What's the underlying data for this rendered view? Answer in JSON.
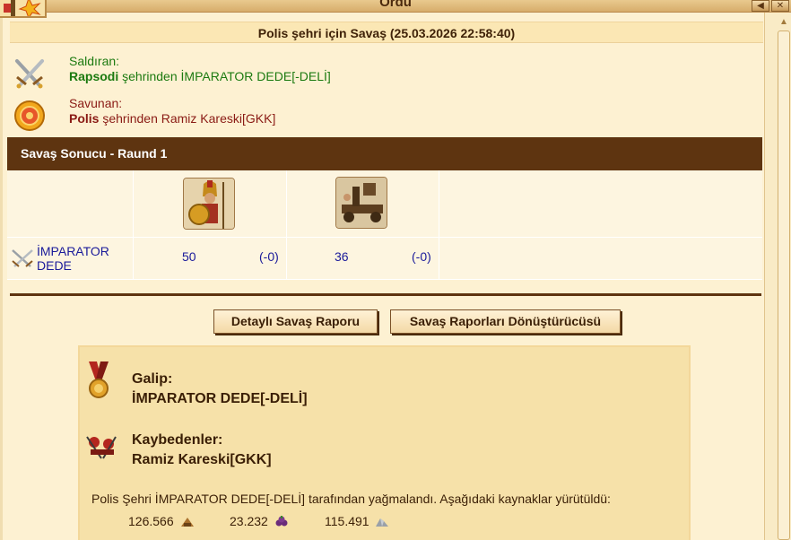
{
  "window": {
    "title": "Ordu",
    "btn_back": "◀",
    "btn_close": "✕"
  },
  "battle": {
    "title": "Polis şehri için Savaş (25.03.2026 22:58:40)",
    "attacker": {
      "role": "Saldıran:",
      "city": "Rapsodi",
      "suffix": "şehrinden",
      "name": "İMPARATOR DEDE[-DELİ]"
    },
    "defender": {
      "role": "Savunan:",
      "city": "Polis",
      "suffix": "şehrinden",
      "name": "Ramiz Kareski[GKK]"
    },
    "round_title": "Savaş Sonucu - Raund 1",
    "units": [
      {
        "icon": "hoplite-icon",
        "count": "50",
        "loss": "(-0)"
      },
      {
        "icon": "catapult-icon",
        "count": "36",
        "loss": "(-0)"
      }
    ],
    "row_player": {
      "line1": "İMPARATOR",
      "line2": "DEDE"
    }
  },
  "buttons": {
    "detailed": "Detaylı Savaş Raporu",
    "converter": "Savaş Raporları Dönüştürücüsü"
  },
  "result": {
    "winner_label": "Galip:",
    "winner": "İMPARATOR DEDE[-DELİ]",
    "losers_label": "Kaybedenler:",
    "losers": "Ramiz Kareski[GKK]",
    "plunder_text": "Polis Şehri İMPARATOR DEDE[-DELİ] tarafından yağmalandı. Aşağıdaki kaynaklar yürütüldü:",
    "resources": [
      {
        "icon": "wood-icon",
        "value": "126.566"
      },
      {
        "icon": "wine-icon",
        "value": "23.232"
      },
      {
        "icon": "marble-icon",
        "value": "115.491"
      }
    ]
  }
}
